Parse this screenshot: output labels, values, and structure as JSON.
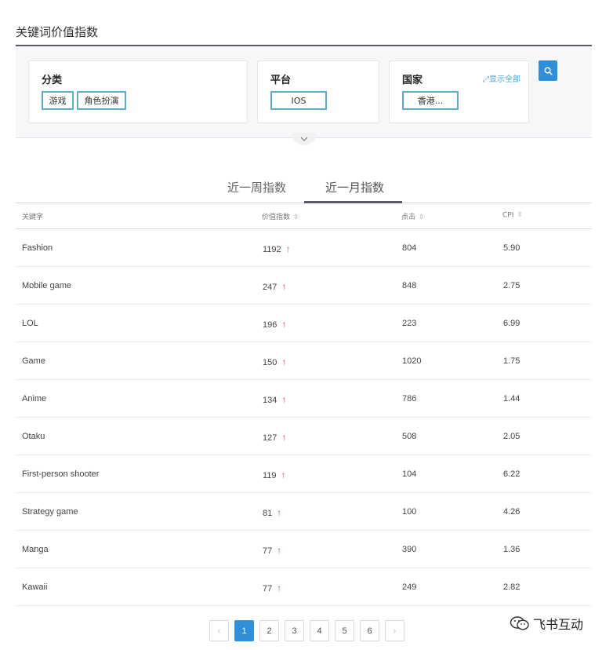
{
  "page_title": "关键词价值指数",
  "filters": {
    "category": {
      "label": "分类",
      "chips": [
        "游戏",
        "角色扮演"
      ]
    },
    "platform": {
      "label": "平台",
      "chips": [
        "IOS"
      ]
    },
    "country": {
      "label": "国家",
      "chips": [
        "香港..."
      ],
      "show_all": "显示全部"
    }
  },
  "search": {
    "icon": "search-icon"
  },
  "tabs": [
    {
      "label": "近一周指数",
      "active": false
    },
    {
      "label": "近一月指数",
      "active": true
    }
  ],
  "table": {
    "headers": [
      "关键字",
      "价值指数",
      "点击",
      "CPI"
    ],
    "rows": [
      {
        "keyword": "Fashion",
        "value": "1192",
        "clicks": "804",
        "cpi": "5.90"
      },
      {
        "keyword": "Mobile game",
        "value": "247",
        "clicks": "848",
        "cpi": "2.75"
      },
      {
        "keyword": "LOL",
        "value": "196",
        "clicks": "223",
        "cpi": "6.99"
      },
      {
        "keyword": "Game",
        "value": "150",
        "clicks": "1020",
        "cpi": "1.75"
      },
      {
        "keyword": "Anime",
        "value": "134",
        "clicks": "786",
        "cpi": "1.44"
      },
      {
        "keyword": "Otaku",
        "value": "127",
        "clicks": "508",
        "cpi": "2.05"
      },
      {
        "keyword": "First-person shooter",
        "value": "119",
        "clicks": "104",
        "cpi": "6.22"
      },
      {
        "keyword": "Strategy game",
        "value": "81",
        "clicks": "100",
        "cpi": "4.26"
      },
      {
        "keyword": "Manga",
        "value": "77",
        "clicks": "390",
        "cpi": "1.36"
      },
      {
        "keyword": "Kawaii",
        "value": "77",
        "clicks": "249",
        "cpi": "2.82"
      }
    ]
  },
  "pagination": {
    "prev": "‹",
    "next": "›",
    "pages": [
      "1",
      "2",
      "3",
      "4",
      "5",
      "6"
    ],
    "current": "1"
  },
  "watermark": {
    "text": "飞书互动"
  },
  "colors": {
    "accent": "#2f8fd8",
    "chip_border": "#5fa9c9",
    "trend_up": "#e85757"
  }
}
